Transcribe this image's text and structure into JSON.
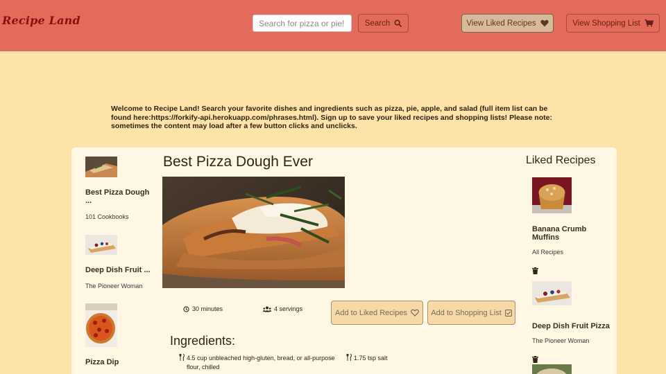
{
  "header": {
    "brand": "Recipe Land",
    "search_placeholder": "Search for pizza or pie!",
    "search_label": "Search",
    "liked_label": "View Liked Recipes",
    "shopping_label": "View Shopping List"
  },
  "welcome_text": "Welcome to Recipe Land! Search your favorite dishes and ingredients such as pizza, pie, apple, and salad (full item list can be found here:https://forkify-api.herokuapp.com/phrases.html). Sign up to save your liked recipes and shopping lists! Please note: sometimes the content may load after a few button clicks and unclicks.",
  "results": [
    {
      "title": "Best Pizza Dough ...",
      "publisher": "101 Cookbooks"
    },
    {
      "title": "Deep Dish Fruit ...",
      "publisher": "The Pioneer Woman"
    },
    {
      "title": "Pizza Dip",
      "publisher": ""
    }
  ],
  "recipe": {
    "title": "Best Pizza Dough Ever",
    "time": "30 minutes",
    "servings": "4 servings",
    "add_liked_label": "Add to Liked Recipes",
    "add_shopping_label": "Add to Shopping List",
    "ingredients_heading": "Ingredients:",
    "ingredients": [
      "4.5 cup unbleached high-gluten, bread, or all-purpose flour, chilled",
      "1.75 tsp salt"
    ]
  },
  "liked": {
    "heading": "Liked Recipes",
    "items": [
      {
        "title": "Banana Crumb Muffins",
        "publisher": "All Recipes"
      },
      {
        "title": "Deep Dish Fruit Pizza",
        "publisher": "The Pioneer Woman"
      }
    ]
  },
  "colors": {
    "header_bg": "#e26b5c",
    "page_bg": "#fde3aa",
    "card_bg": "#fff6e3",
    "button_bg": "#f7d9a8"
  }
}
